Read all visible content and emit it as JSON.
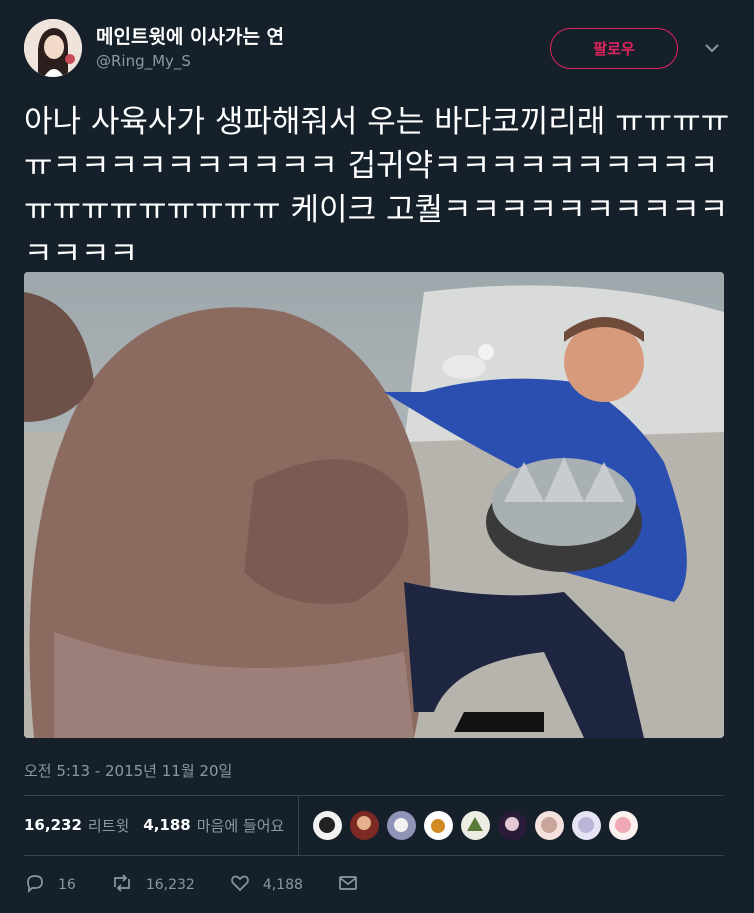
{
  "user": {
    "display_name": "메인트윗에 이사가는 연",
    "handle": "@Ring_My_S"
  },
  "follow_button_label": "팔로우",
  "tweet": {
    "text": "아나 사육사가 생파해줘서 우는 바다코끼리래 ㅠㅠㅠㅠㅠㅋㅋㅋㅋㅋㅋㅋㅋㅋㅋ 겁귀약ㅋㅋㅋㅋㅋㅋㅋㅋㅋㅋㅠㅠㅠㅠㅠㅠㅠㅠㅠ 케이크 고퀄ㅋㅋㅋㅋㅋㅋㅋㅋㅋㅋㅋㅋㅋㅋ",
    "timestamp": "오전 5:13 - 2015년 11월 20일"
  },
  "stats": {
    "retweets_count": "16,232",
    "retweets_label": "리트윗",
    "likes_count": "4,188",
    "likes_label": "마음에 들어요"
  },
  "actions": {
    "reply_count": "16",
    "retweet_count": "16,232",
    "like_count": "4,188"
  },
  "colors": {
    "background": "#15202b",
    "secondary_text": "#8899a6",
    "follow_accent": "#e0245e",
    "divider": "#38444d"
  },
  "icons": [
    "reply-icon",
    "retweet-icon",
    "like-icon",
    "message-icon",
    "chevron-down-icon"
  ]
}
